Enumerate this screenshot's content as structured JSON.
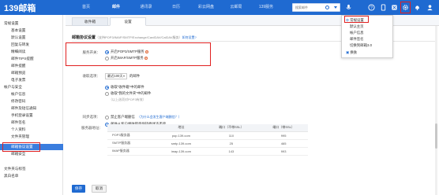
{
  "app": {
    "logo": "139邮箱"
  },
  "topnav": [
    "首页",
    "邮件",
    "通讯录",
    "日历",
    "彩云网盘",
    "云邮局",
    "139服务"
  ],
  "search": {
    "placeholder": "搜索邮件"
  },
  "sidebar": {
    "items": [
      {
        "label": "常规设置",
        "kind": "grp"
      },
      {
        "label": "基本设置",
        "kind": "sub"
      },
      {
        "label": "默认设置",
        "kind": "sub"
      },
      {
        "label": "回复与转发",
        "kind": "sub"
      },
      {
        "label": "精细阅读",
        "kind": "sub"
      },
      {
        "label": "邮件TIPS提醒",
        "kind": "sub"
      },
      {
        "label": "邮件提醒",
        "kind": "sub"
      },
      {
        "label": "邮箱预览",
        "kind": "sub"
      },
      {
        "label": "电子发票",
        "kind": "sub"
      },
      {
        "label": "帐户与安全",
        "kind": "grp"
      },
      {
        "label": "帐户信息",
        "kind": "sub"
      },
      {
        "label": "修改密码",
        "kind": "sub"
      },
      {
        "label": "邮件及短信通知",
        "kind": "sub"
      },
      {
        "label": "手机登录设置",
        "kind": "sub"
      },
      {
        "label": "邮件签名",
        "kind": "sub"
      },
      {
        "label": "个人资料",
        "kind": "sub"
      },
      {
        "label": "文件夹管理",
        "kind": "sub"
      },
      {
        "label": "邮箱协议设置",
        "kind": "sub",
        "selected": true
      },
      {
        "label": "邮箱安全",
        "kind": "sub"
      },
      {
        "label": "文件夹与标签",
        "kind": "grp"
      },
      {
        "label": "黑白名单",
        "kind": "grp"
      }
    ]
  },
  "tabs": [
    {
      "label": "收件箱"
    },
    {
      "label": "设置",
      "active": true
    }
  ],
  "section": {
    "title": "邮箱协议设置",
    "hint": "（支持POP3/IMAP/SMTP/Exchange/CardDAV/CalDAV服务）",
    "help_link": "如何设置?"
  },
  "service": {
    "label": "服务开关：",
    "options": [
      "开启POP3/SMTP服务",
      "开启IMAP/SMTP服务"
    ]
  },
  "receive": {
    "label": "收取选项：",
    "select_value": "最近100天",
    "select_suffix": "的邮件",
    "options": [
      "收取\"收件箱\"中的邮件",
      "收取\"我的文件夹\"中的邮件"
    ],
    "note": "（以上选项对POP3有效）"
  },
  "sync": {
    "label": "同步选项：",
    "options": [
      "禁止客户端删信",
      "邮件从客户端收取后保持原状态不变"
    ],
    "link": "（为什么会发生客户端删信？）",
    "note": "（以上选项对POP3有效）"
  },
  "servers": {
    "label": "服务器地址：",
    "headers": [
      "",
      "地址",
      "端口（不带SSL）",
      "端口（带SSL）"
    ],
    "rows": [
      [
        "POP3服务器",
        "pop.139.com",
        "110",
        "995"
      ],
      [
        "SMTP服务器",
        "smtp.139.com",
        "25",
        "465"
      ],
      [
        "IMAP服务器",
        "imap.139.com",
        "143",
        "993"
      ]
    ]
  },
  "buttons": {
    "save": "保存",
    "cancel": "取消"
  },
  "settings_menu": {
    "items": [
      "常规设置",
      "默认主页",
      "帐户信息",
      "邮件签名",
      "切换到邮箱3.0",
      "换肤"
    ]
  },
  "colors": {
    "brand": "#1f6ad1",
    "highlight": "#e02020"
  }
}
